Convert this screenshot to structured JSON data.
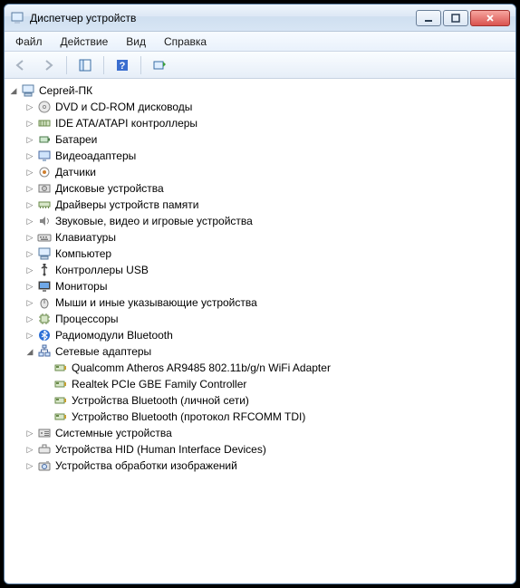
{
  "window": {
    "title": "Диспетчер устройств"
  },
  "menu": {
    "file": "Файл",
    "action": "Действие",
    "view": "Вид",
    "help": "Справка"
  },
  "tree": {
    "root": "Сергей-ПК",
    "categories": [
      {
        "label": "DVD и CD-ROM дисководы",
        "icon": "disc",
        "expanded": false
      },
      {
        "label": "IDE ATA/ATAPI контроллеры",
        "icon": "ide",
        "expanded": false
      },
      {
        "label": "Батареи",
        "icon": "battery",
        "expanded": false
      },
      {
        "label": "Видеоадаптеры",
        "icon": "display",
        "expanded": false
      },
      {
        "label": "Датчики",
        "icon": "sensor",
        "expanded": false
      },
      {
        "label": "Дисковые устройства",
        "icon": "drive",
        "expanded": false
      },
      {
        "label": "Драйверы устройств памяти",
        "icon": "memory",
        "expanded": false
      },
      {
        "label": "Звуковые, видео и игровые устройства",
        "icon": "sound",
        "expanded": false
      },
      {
        "label": "Клавиатуры",
        "icon": "keyboard",
        "expanded": false
      },
      {
        "label": "Компьютер",
        "icon": "computer",
        "expanded": false
      },
      {
        "label": "Контроллеры USB",
        "icon": "usb",
        "expanded": false
      },
      {
        "label": "Мониторы",
        "icon": "monitor",
        "expanded": false
      },
      {
        "label": "Мыши и иные указывающие устройства",
        "icon": "mouse",
        "expanded": false
      },
      {
        "label": "Процессоры",
        "icon": "cpu",
        "expanded": false
      },
      {
        "label": "Радиомодули Bluetooth",
        "icon": "bluetooth",
        "expanded": false
      },
      {
        "label": "Сетевые адаптеры",
        "icon": "network",
        "expanded": true,
        "children": [
          {
            "label": "Qualcomm Atheros AR9485 802.11b/g/n WiFi Adapter",
            "icon": "netcard"
          },
          {
            "label": "Realtek PCIe GBE Family Controller",
            "icon": "netcard"
          },
          {
            "label": "Устройства Bluetooth (личной сети)",
            "icon": "netcard"
          },
          {
            "label": "Устройство Bluetooth (протокол RFCOMM TDI)",
            "icon": "netcard"
          }
        ]
      },
      {
        "label": "Системные устройства",
        "icon": "system",
        "expanded": false
      },
      {
        "label": "Устройства HID (Human Interface Devices)",
        "icon": "hid",
        "expanded": false
      },
      {
        "label": "Устройства обработки изображений",
        "icon": "imaging",
        "expanded": false
      }
    ]
  }
}
